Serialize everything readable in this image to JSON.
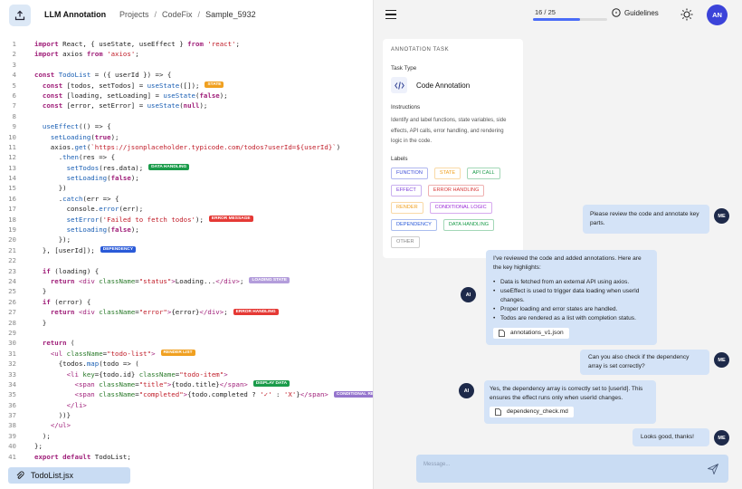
{
  "app": {
    "title": "LLM Annotation"
  },
  "breadcrumb": [
    "Projects",
    "CodeFix",
    "Sample_5932"
  ],
  "file_tab": {
    "name": "TodoList.jsx"
  },
  "progress": {
    "text": "16 / 25",
    "current": 16,
    "total": 25
  },
  "toolbar": {
    "guidelines_label": "Guidelines"
  },
  "user": {
    "initials": "AN"
  },
  "annotation_panel": {
    "header": "ANNOTATION TASK",
    "task_type_label": "Task Type",
    "task_type": "Code Annotation",
    "instructions_label": "Instructions",
    "instructions": "Identify and label functions, state variables, side effects, API calls, error handling, and rendering logic in the code.",
    "labels_label": "Labels",
    "labels": [
      {
        "text": "FUNCTION",
        "color": "#3b4bd8"
      },
      {
        "text": "STATE",
        "color": "#f0a020"
      },
      {
        "text": "API CALL",
        "color": "#1a9b4a"
      },
      {
        "text": "EFFECT",
        "color": "#7a3bd8"
      },
      {
        "text": "ERROR HANDLING",
        "color": "#d83b3b"
      },
      {
        "text": "RENDER",
        "color": "#f0a020"
      },
      {
        "text": "CONDITIONAL LOGIC",
        "color": "#9b2ad8"
      },
      {
        "text": "DEPENDENCY",
        "color": "#2a5ad8"
      },
      {
        "text": "DATA HANDLING",
        "color": "#1a9b4a"
      },
      {
        "text": "OTHER",
        "color": "#888888"
      }
    ]
  },
  "code_tags": {
    "state": {
      "text": "STATE",
      "color": "#f0a020"
    },
    "data_handling": {
      "text": "DATA HANDLING",
      "color": "#1a9b4a"
    },
    "error_message": {
      "text": "ERROR MESSAGE",
      "color": "#e53935"
    },
    "dependency": {
      "text": "DEPENDENCY",
      "color": "#2a5ad8"
    },
    "loading_state": {
      "text": "LOADING STATE",
      "color": "#b39ddb"
    },
    "error_handling": {
      "text": "ERROR HANDLING",
      "color": "#e53935"
    },
    "render_list": {
      "text": "RENDER LIST",
      "color": "#f0a020"
    },
    "display_data": {
      "text": "DISPLAY DATA",
      "color": "#1a9b4a"
    },
    "conditional_render": {
      "text": "CONDITIONAL RENDER",
      "color": "#9575cd"
    }
  },
  "chat": {
    "messages": [
      {
        "role": "user",
        "avatar": "ME",
        "text": "Please review the code and annotate key parts."
      },
      {
        "role": "ai",
        "avatar": "AI",
        "intro": "I've reviewed the code and added annotations. Here are the key highlights:",
        "bullets": [
          "Data is fetched from an external API using axios.",
          "useEffect is used to trigger data loading when userId changes.",
          "Proper loading and error states are handled.",
          "Todos are rendered as a list with completion status."
        ],
        "attachment": "annotations_v1.json"
      },
      {
        "role": "user",
        "avatar": "ME",
        "text": "Can you also check if the dependency array is set correctly?"
      },
      {
        "role": "ai",
        "avatar": "AI",
        "text": "Yes, the dependency array is correctly set to [userId]. This ensures the effect runs only when userId changes.",
        "attachment": "dependency_check.md"
      },
      {
        "role": "user",
        "avatar": "ME",
        "text": "Looks good, thanks!"
      }
    ],
    "composer_placeholder": "Message..."
  }
}
